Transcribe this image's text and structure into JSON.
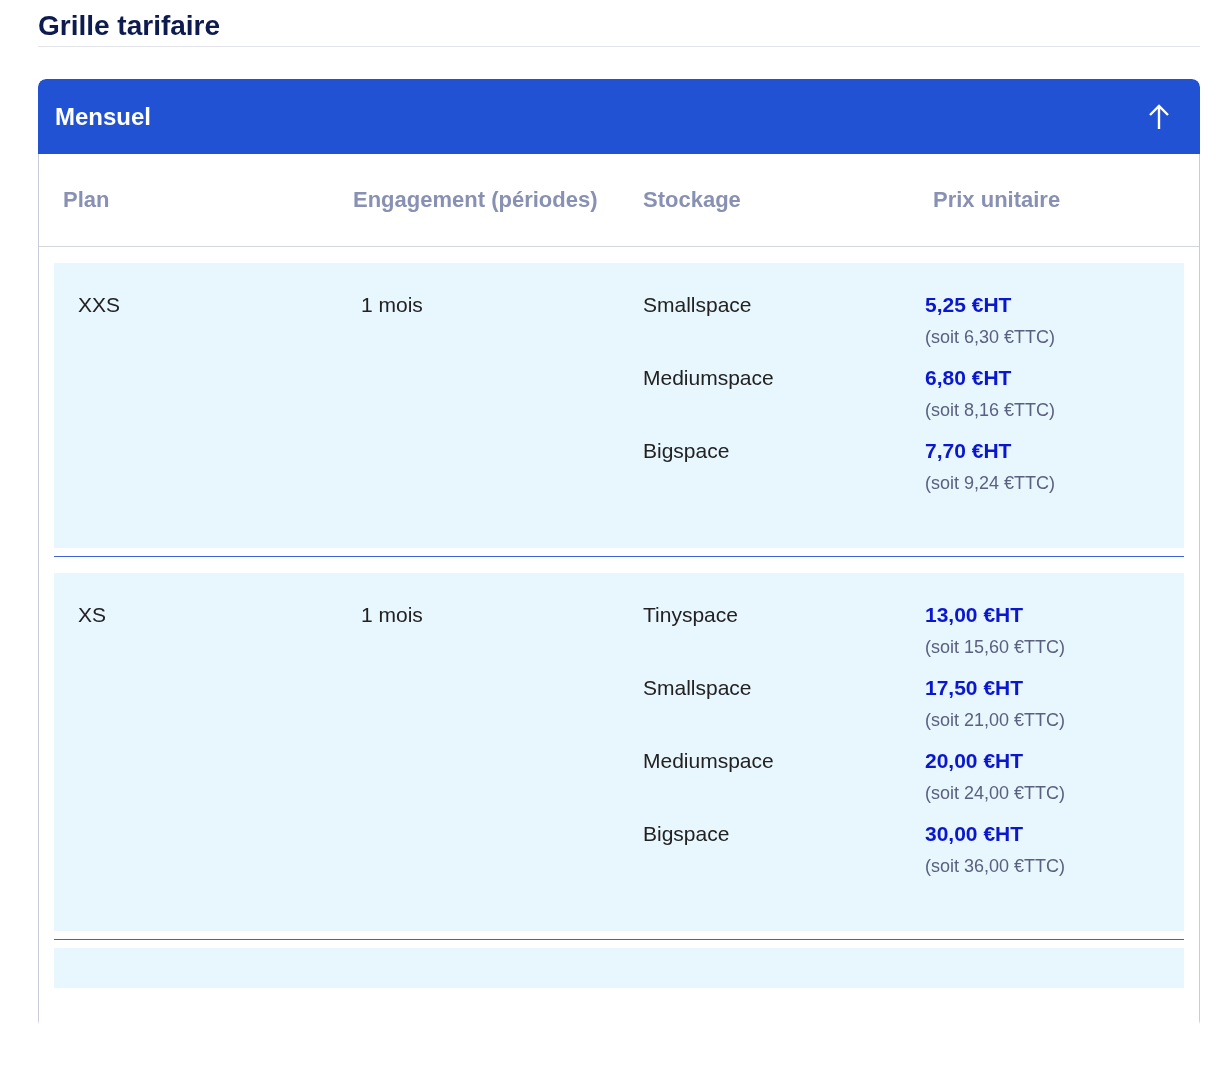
{
  "title": "Grille tarifaire",
  "accordion": {
    "title": "Mensuel",
    "expanded": true
  },
  "table": {
    "columns": [
      "Plan",
      "Engagement (périodes)",
      "Stockage",
      "Prix unitaire"
    ],
    "rows": [
      {
        "plan": "XXS",
        "engagement": "1 mois",
        "options": [
          {
            "storage": "Smallspace",
            "price": "5,25 €HT",
            "price_ttc": "(soit 6,30 €TTC)"
          },
          {
            "storage": "Mediumspace",
            "price": "6,80 €HT",
            "price_ttc": "(soit 8,16 €TTC)"
          },
          {
            "storage": "Bigspace",
            "price": "7,70 €HT",
            "price_ttc": "(soit 9,24 €TTC)"
          }
        ]
      },
      {
        "plan": "XS",
        "engagement": "1 mois",
        "options": [
          {
            "storage": "Tinyspace",
            "price": "13,00 €HT",
            "price_ttc": "(soit 15,60 €TTC)"
          },
          {
            "storage": "Smallspace",
            "price": "17,50 €HT",
            "price_ttc": "(soit 21,00 €TTC)"
          },
          {
            "storage": "Mediumspace",
            "price": "20,00 €HT",
            "price_ttc": "(soit 24,00 €TTC)"
          },
          {
            "storage": "Bigspace",
            "price": "30,00 €HT",
            "price_ttc": "(soit 36,00 €TTC)"
          }
        ]
      }
    ]
  }
}
